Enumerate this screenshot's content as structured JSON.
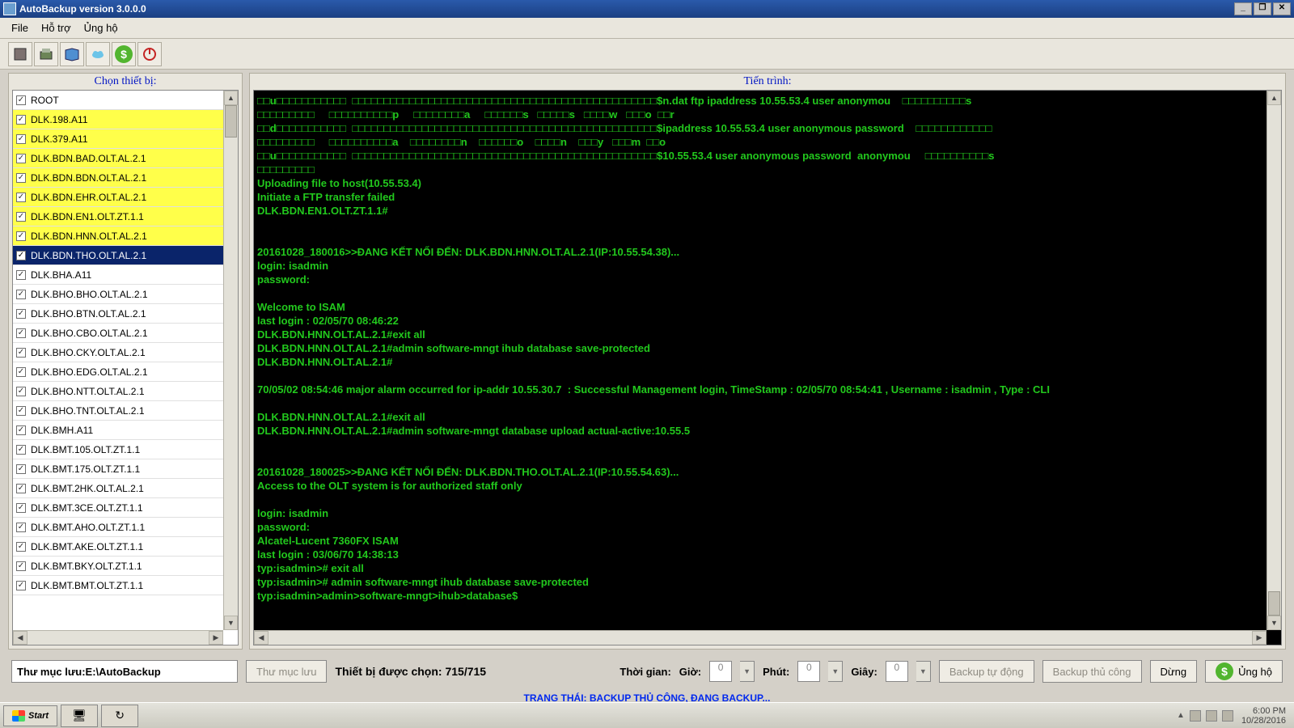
{
  "window": {
    "title": "AutoBackup version 3.0.0.0"
  },
  "menu": {
    "file": "File",
    "help": "Hỗ trợ",
    "donate": "Ủng hộ"
  },
  "left": {
    "title": "Chọn thiết bị:",
    "root": "ROOT",
    "items": [
      {
        "label": "DLK.198.A11",
        "hl": true
      },
      {
        "label": "DLK.379.A11",
        "hl": true
      },
      {
        "label": "DLK.BDN.BAD.OLT.AL.2.1",
        "hl": true
      },
      {
        "label": "DLK.BDN.BDN.OLT.AL.2.1",
        "hl": true
      },
      {
        "label": "DLK.BDN.EHR.OLT.AL.2.1",
        "hl": true
      },
      {
        "label": "DLK.BDN.EN1.OLT.ZT.1.1",
        "hl": true
      },
      {
        "label": "DLK.BDN.HNN.OLT.AL.2.1",
        "hl": true
      },
      {
        "label": "DLK.BDN.THO.OLT.AL.2.1",
        "sel": true
      },
      {
        "label": "DLK.BHA.A11"
      },
      {
        "label": "DLK.BHO.BHO.OLT.AL.2.1"
      },
      {
        "label": "DLK.BHO.BTN.OLT.AL.2.1"
      },
      {
        "label": "DLK.BHO.CBO.OLT.AL.2.1"
      },
      {
        "label": "DLK.BHO.CKY.OLT.AL.2.1"
      },
      {
        "label": "DLK.BHO.EDG.OLT.AL.2.1"
      },
      {
        "label": "DLK.BHO.NTT.OLT.AL.2.1"
      },
      {
        "label": "DLK.BHO.TNT.OLT.AL.2.1"
      },
      {
        "label": "DLK.BMH.A11"
      },
      {
        "label": "DLK.BMT.105.OLT.ZT.1.1"
      },
      {
        "label": "DLK.BMT.175.OLT.ZT.1.1"
      },
      {
        "label": "DLK.BMT.2HK.OLT.AL.2.1"
      },
      {
        "label": "DLK.BMT.3CE.OLT.ZT.1.1"
      },
      {
        "label": "DLK.BMT.AHO.OLT.ZT.1.1"
      },
      {
        "label": "DLK.BMT.AKE.OLT.ZT.1.1"
      },
      {
        "label": "DLK.BMT.BKY.OLT.ZT.1.1"
      },
      {
        "label": "DLK.BMT.BMT.OLT.ZT.1.1"
      }
    ]
  },
  "proc": {
    "title": "Tiến trình:",
    "lines": [
      "□□u□□□□□□□□□□□  □□□□□□□□□□□□□□□□□□□□□□□□□□□□□□□□□□□□□□□□□□□□□□□□$n.dat ftp ipaddress 10.55.53.4 user anonymou    □□□□□□□□□□s",
      "□□□□□□□□□     □□□□□□□□□□p     □□□□□□□□a     □□□□□□s   □□□□□s   □□□□w   □□□o  □□r",
      "□□d□□□□□□□□□□□  □□□□□□□□□□□□□□□□□□□□□□□□□□□□□□□□□□□□□□□□□□□□□□□□$ipaddress 10.55.53.4 user anonymous password    □□□□□□□□□□□□",
      "□□□□□□□□□     □□□□□□□□□□a    □□□□□□□□n    □□□□□□o    □□□□n    □□□y   □□□m  □□o",
      "□□u□□□□□□□□□□□  □□□□□□□□□□□□□□□□□□□□□□□□□□□□□□□□□□□□□□□□□□□□□□□□$10.55.53.4 user anonymous password  anonymou     □□□□□□□□□□s",
      "□□□□□□□□□",
      "Uploading file to host(10.55.53.4)",
      "Initiate a FTP transfer failed",
      "DLK.BDN.EN1.OLT.ZT.1.1#",
      "",
      "",
      "20161028_180016>>ĐANG KẾT NỐI ĐẾN: DLK.BDN.HNN.OLT.AL.2.1(IP:10.55.54.38)...",
      "login: isadmin",
      "password:",
      "",
      "Welcome to ISAM",
      "last login : 02/05/70 08:46:22",
      "DLK.BDN.HNN.OLT.AL.2.1#exit all",
      "DLK.BDN.HNN.OLT.AL.2.1#admin software-mngt ihub database save-protected",
      "DLK.BDN.HNN.OLT.AL.2.1#",
      "",
      "70/05/02 08:54:46 major alarm occurred for ip-addr 10.55.30.7  : Successful Management login, TimeStamp : 02/05/70 08:54:41 , Username : isadmin , Type : CLI",
      "",
      "DLK.BDN.HNN.OLT.AL.2.1#exit all",
      "DLK.BDN.HNN.OLT.AL.2.1#admin software-mngt database upload actual-active:10.55.5",
      "",
      "",
      "20161028_180025>>ĐANG KẾT NỐI ĐẾN: DLK.BDN.THO.OLT.AL.2.1(IP:10.55.54.63)...",
      "Access to the OLT system is for authorized staff only",
      "",
      "login: isadmin",
      "password:",
      "Alcatel-Lucent 7360FX ISAM",
      "last login : 03/06/70 14:38:13",
      "typ:isadmin># exit all",
      "typ:isadmin># admin software-mngt ihub database save-protected",
      "typ:isadmin>admin>software-mngt>ihub>database$"
    ]
  },
  "bottom": {
    "savedir_label": "Thư mục lưu: ",
    "savedir_value": "E:\\AutoBackup",
    "browse": "Thư mục lưu",
    "countlabel": "Thiết bị được chọn: 715/715",
    "timelabel": "Thời gian:",
    "hourlabel": "Giờ:",
    "minlabel": "Phút:",
    "seclabel": "Giây:",
    "hour": "0",
    "min": "0",
    "sec": "0",
    "autobackup": "Backup tự động",
    "manualbackup": "Backup thủ công",
    "stop": "Dừng",
    "donate": "Ủng hộ"
  },
  "status": "TRẠNG THÁI: BACKUP THỦ CÔNG, ĐANG BACKUP...",
  "taskbar": {
    "start": "Start",
    "time": "6:00 PM",
    "date": "10/28/2016"
  }
}
